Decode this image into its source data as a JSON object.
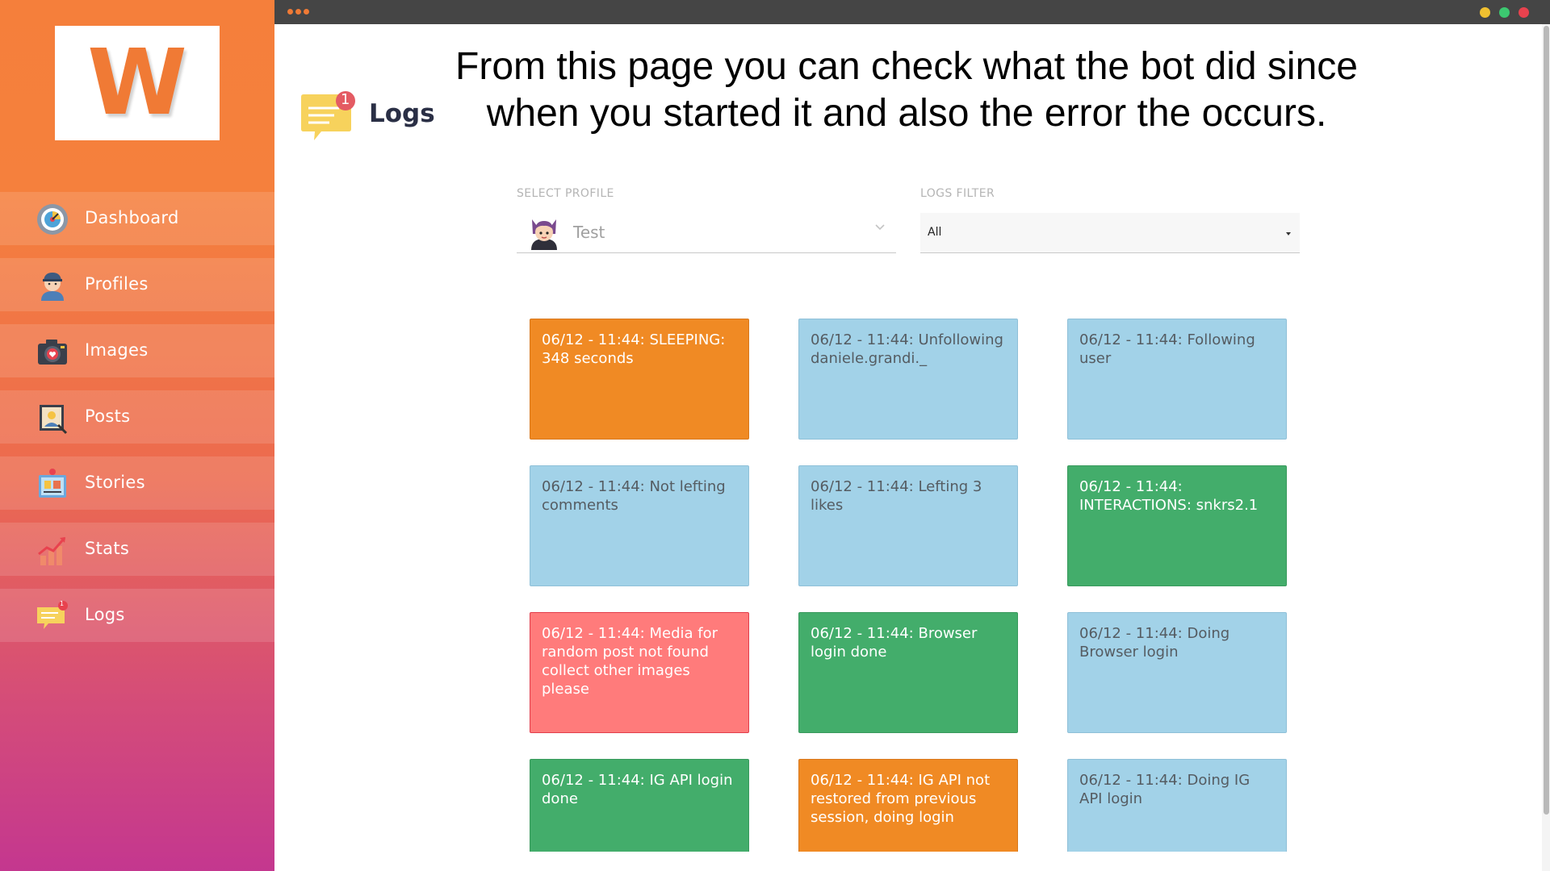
{
  "app": {
    "logo_letter": "W",
    "brand_color": "#f57f3b"
  },
  "sidebar": {
    "items": [
      {
        "label": "Dashboard",
        "icon": "dashboard-gauge-icon"
      },
      {
        "label": "Profiles",
        "icon": "profile-avatar-icon"
      },
      {
        "label": "Images",
        "icon": "camera-icon"
      },
      {
        "label": "Posts",
        "icon": "post-picture-icon"
      },
      {
        "label": "Stories",
        "icon": "stories-icon"
      },
      {
        "label": "Stats",
        "icon": "stats-chart-icon"
      },
      {
        "label": "Logs",
        "icon": "logs-chat-icon",
        "badge": "1"
      }
    ],
    "active": "Logs"
  },
  "header": {
    "title": "Logs",
    "badge": "1",
    "instruction": "From this page you can check what the bot did since when you started it and also the error the occurs."
  },
  "controls": {
    "profile_label": "SELECT PROFILE",
    "profile_value": "Test",
    "filter_label": "LOGS FILTER",
    "filter_value": "All"
  },
  "logs": [
    {
      "text": "06/12 - 11:44: SLEEPING: 348 seconds",
      "type": "warning"
    },
    {
      "text": "06/12 - 11:44: Unfollowing daniele.grandi._",
      "type": "info"
    },
    {
      "text": "06/12 - 11:44: Following user",
      "type": "info"
    },
    {
      "text": "06/12 - 11:44: Not lefting comments",
      "type": "info"
    },
    {
      "text": "06/12 - 11:44: Lefting 3 likes",
      "type": "info"
    },
    {
      "text": "06/12 - 11:44: INTERACTIONS: snkrs2.1",
      "type": "success"
    },
    {
      "text": "06/12 - 11:44: Media for random post not found collect other images please",
      "type": "error"
    },
    {
      "text": "06/12 - 11:44: Browser login done",
      "type": "success"
    },
    {
      "text": "06/12 - 11:44: Doing Browser login",
      "type": "info"
    },
    {
      "text": "06/12 - 11:44: IG API login done",
      "type": "success"
    },
    {
      "text": "06/12 - 11:44: IG API not restored from previous session, doing login",
      "type": "warning"
    },
    {
      "text": "06/12 - 11:44: Doing IG API login",
      "type": "info"
    }
  ],
  "colors": {
    "warning": "#f08a24",
    "info": "#a2d2e8",
    "success": "#43ad6b",
    "error": "#ff7b7b"
  }
}
